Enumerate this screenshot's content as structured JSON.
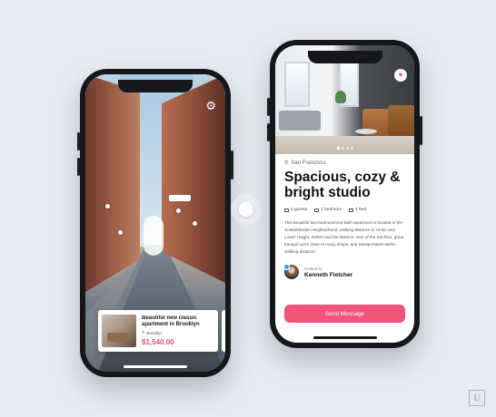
{
  "explore_screen": {
    "listing": {
      "title": "Beautiful new classic apartment in Brooklyn",
      "location": "Brooklyn",
      "price": "$1,540.00"
    },
    "settings_icon": "gear-icon"
  },
  "detail_screen": {
    "location": "San Francisco",
    "title": "Spacious, cozy & bright studio",
    "amenities": [
      {
        "label": "2 guests",
        "icon": "user-icon"
      },
      {
        "label": "1 bedroom",
        "icon": "bed-icon"
      },
      {
        "label": "1 bed",
        "icon": "bed-icon"
      }
    ],
    "description": "This beautiful two-bedroom/one-bath apartment is located in the SoMa/Mission neighborhood, walking distance to Union and Lower Haight, SOMA and the Mission. One of the top-floor, great tranquil unit's close to many shops, and transportation within walking distance.",
    "host": {
      "label": "Hosted by",
      "name": "Kenneth Fletcher"
    },
    "send_label": "Send Message",
    "favorite_icon": "heart-icon"
  },
  "colors": {
    "accent": "#ef4b72",
    "background": "#e8ecf2"
  }
}
